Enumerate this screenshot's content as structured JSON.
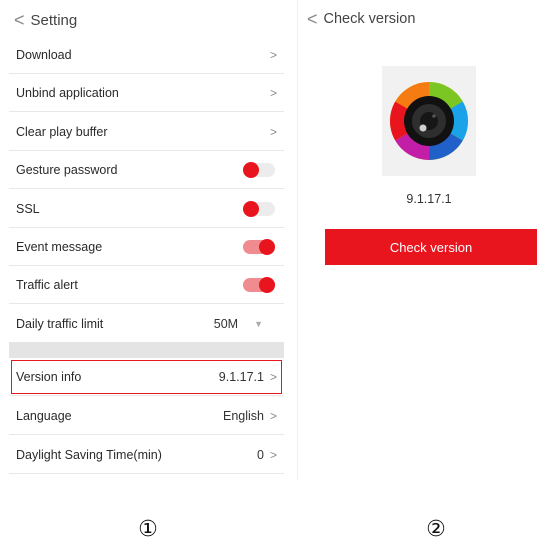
{
  "settings": {
    "title": "Setting",
    "back_icon": "chevron-left-icon",
    "items": [
      {
        "label": "Download",
        "control": "chevron"
      },
      {
        "label": "Unbind application",
        "control": "chevron"
      },
      {
        "label": "Clear play buffer",
        "control": "chevron"
      },
      {
        "label": "Gesture password",
        "control": "toggle",
        "on": false
      },
      {
        "label": "SSL",
        "control": "toggle",
        "on": false
      },
      {
        "label": "Event message",
        "control": "toggle",
        "on": true
      },
      {
        "label": "Traffic alert",
        "control": "toggle",
        "on": true
      },
      {
        "label": "Daily traffic limit",
        "control": "dropdown",
        "value": "50M"
      },
      {
        "label": "Version info",
        "control": "value-chevron",
        "value": "9.1.17.1",
        "highlighted": true
      },
      {
        "label": "Language",
        "control": "value-chevron",
        "value": "English"
      },
      {
        "label": "Daylight Saving Time(min)",
        "control": "value-chevron",
        "value": "0"
      }
    ],
    "chevron_glyph": ">",
    "dropdown_glyph": "▼"
  },
  "check_version": {
    "title": "Check version",
    "version": "9.1.17.1",
    "button_label": "Check version",
    "icon": "camera-lens-rainbow-icon"
  },
  "markers": [
    "①",
    "②"
  ],
  "colors": {
    "accent": "#e8141e",
    "toggle_on_track": "#f08c90",
    "toggle_off_track": "#ececec",
    "separator": "#e4e4e4"
  }
}
